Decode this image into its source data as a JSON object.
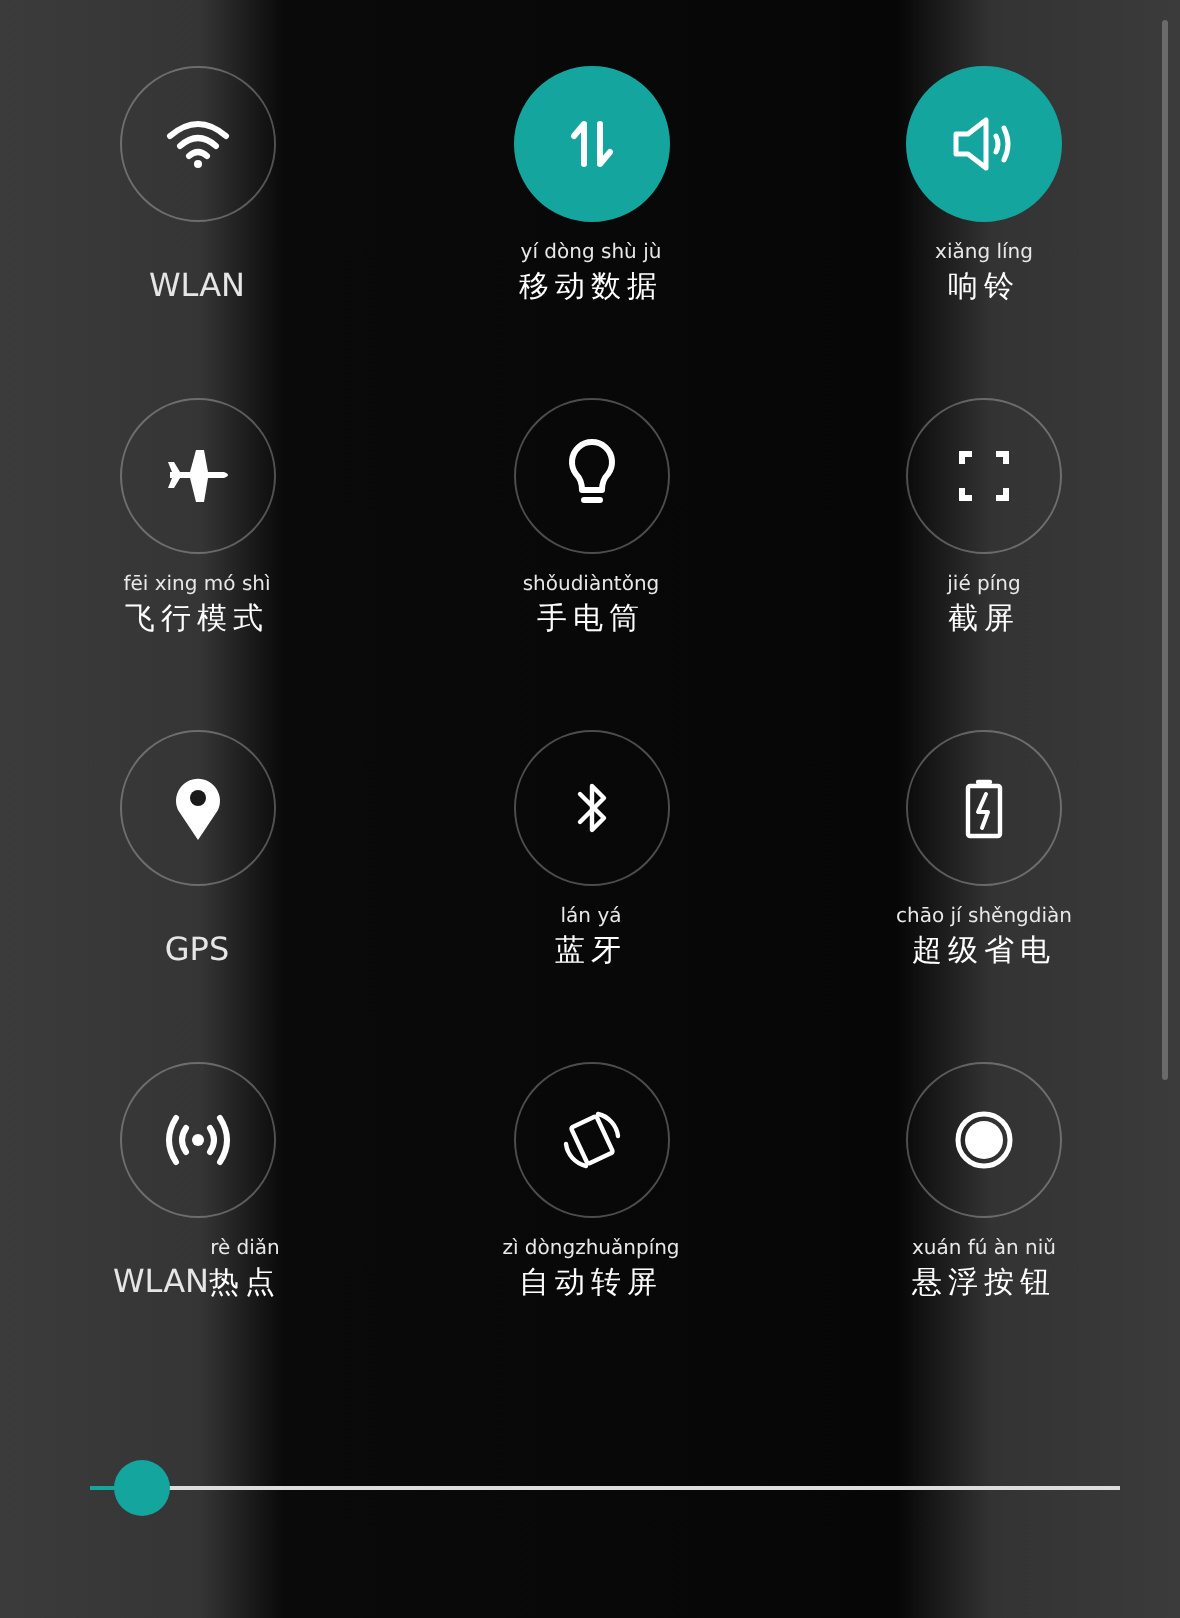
{
  "tiles": [
    {
      "kind": "wifi",
      "label": "WLAN",
      "on": false
    },
    {
      "kind": "data",
      "pinyin": "yí dòng shù jù",
      "label": "移动数据",
      "on": true
    },
    {
      "kind": "sound",
      "pinyin": "xiǎng líng",
      "label": "响铃",
      "on": true
    },
    {
      "kind": "airplane",
      "pinyin": "fēi xing mó shì",
      "label": "飞行模式",
      "on": false
    },
    {
      "kind": "bulb",
      "pinyin": "shǒudiàntǒng",
      "label": "手电筒",
      "on": false
    },
    {
      "kind": "screenshot",
      "pinyin": "jié píng",
      "label": "截屏",
      "on": false
    },
    {
      "kind": "pin",
      "label": "GPS",
      "on": false
    },
    {
      "kind": "bluetooth",
      "pinyin": "lán yá",
      "label": "蓝牙",
      "on": false
    },
    {
      "kind": "battery",
      "pinyin": "chāo jí shěngdiàn",
      "label": "超级省电",
      "on": false
    },
    {
      "kind": "hotspot",
      "prefix": "WLAN",
      "pinyin": "rè diǎn",
      "label": "热点",
      "on": false
    },
    {
      "kind": "rotate",
      "pinyin": "zì dòngzhuǎnpíng",
      "label": "自动转屏",
      "on": false
    },
    {
      "kind": "float",
      "pinyin": "xuán fú àn niǔ",
      "label": "悬浮按钮",
      "on": false
    }
  ],
  "brightness": {
    "level": 0.05
  }
}
